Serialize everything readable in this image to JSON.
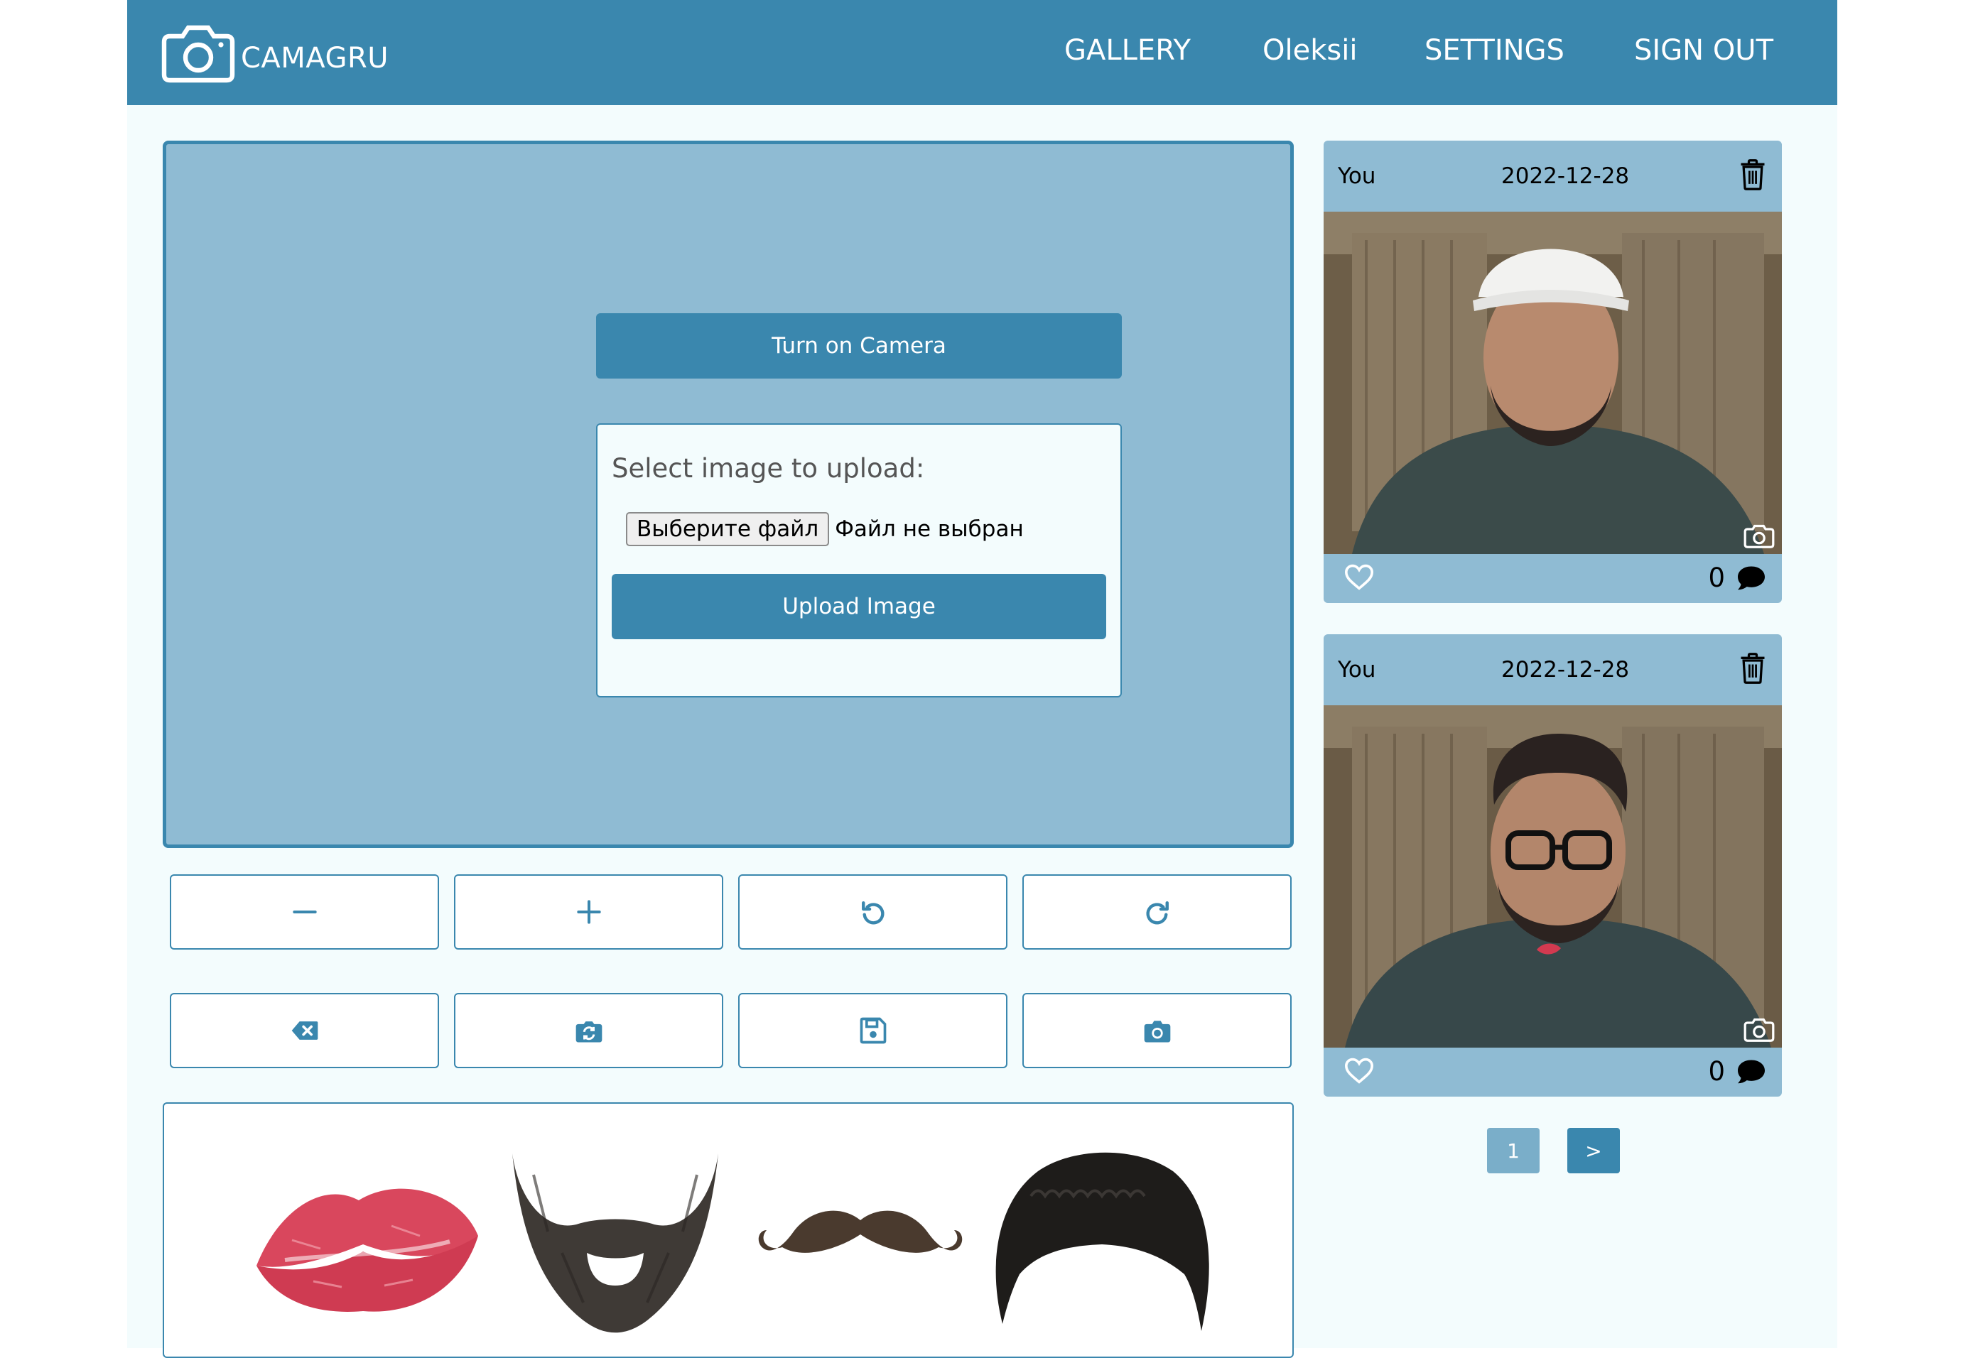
{
  "navbar": {
    "brand": "CAMAGRU",
    "links": {
      "gallery": "GALLERY",
      "user": "Oleksii",
      "settings": "SETTINGS",
      "signout": "SIGN OUT"
    }
  },
  "editor": {
    "camera_button": "Turn on Camera",
    "upload": {
      "title": "Select image to upload:",
      "file_button": "Выберите файл",
      "file_status": "Файл не выбран",
      "upload_button": "Upload Image"
    },
    "controls_row1": [
      "zoom-out",
      "zoom-in",
      "rotate-left",
      "rotate-right"
    ],
    "controls_row2": [
      "clear",
      "switch-camera",
      "save",
      "take-photo"
    ]
  },
  "stickers": [
    "lips",
    "beard",
    "mustache",
    "hair"
  ],
  "posts": [
    {
      "author": "You",
      "date": "2022-12-28",
      "comments": "0",
      "overlay": "white cap"
    },
    {
      "author": "You",
      "date": "2022-12-28",
      "comments": "0",
      "overlay": "glasses and lips"
    }
  ],
  "pagination": {
    "current": "1",
    "next": ">"
  },
  "colors": {
    "primary": "#3a87ae",
    "panel": "#8fbbd3",
    "background": "#f3fcfd"
  }
}
